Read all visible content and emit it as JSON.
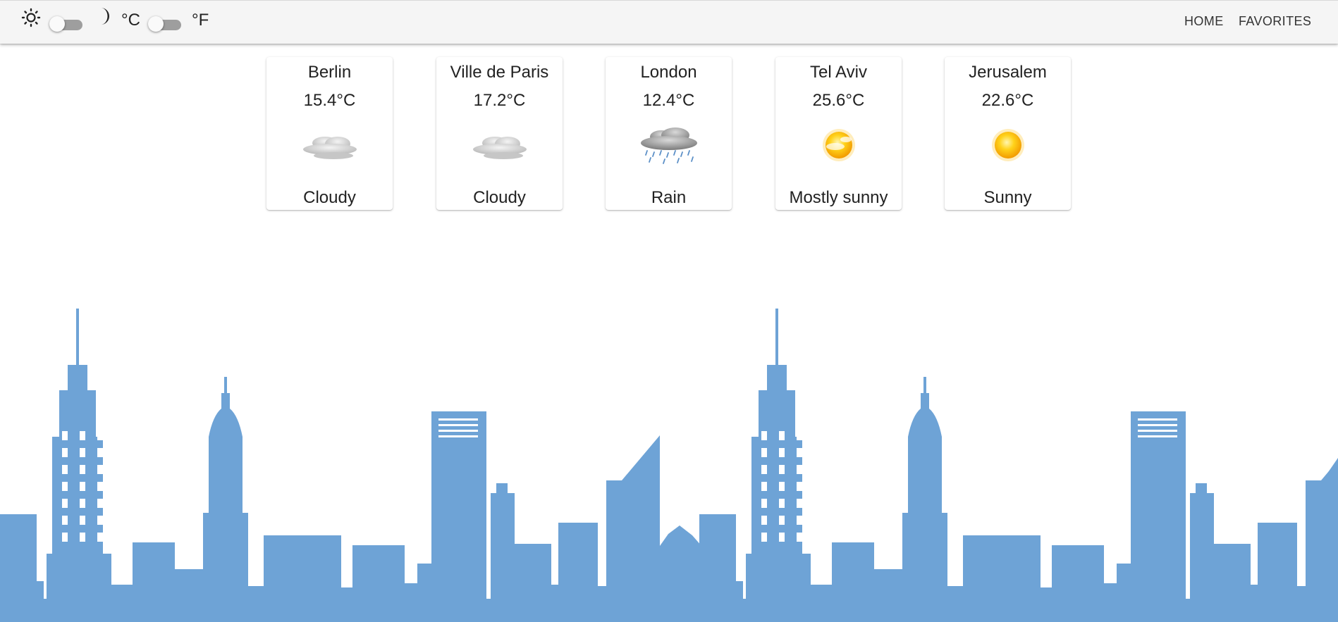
{
  "header": {
    "theme_light_icon": "sun-icon",
    "theme_dark_icon": "moon-icon",
    "unit_celsius": "°C",
    "unit_fahrenheit": "°F",
    "nav": {
      "home": "HOME",
      "favorites": "FAVORITES"
    }
  },
  "cities": [
    {
      "name": "Berlin",
      "temp": "15.4°C",
      "condition": "Cloudy",
      "icon": "cloudy-icon"
    },
    {
      "name": "Ville de Paris",
      "temp": "17.2°C",
      "condition": "Cloudy",
      "icon": "cloudy-icon"
    },
    {
      "name": "London",
      "temp": "12.4°C",
      "condition": "Rain",
      "icon": "rain-icon"
    },
    {
      "name": "Tel Aviv",
      "temp": "25.6°C",
      "condition": "Mostly sunny",
      "icon": "mostly-sunny-icon"
    },
    {
      "name": "Jerusalem",
      "temp": "22.6°C",
      "condition": "Sunny",
      "icon": "sunny-icon"
    }
  ],
  "colors": {
    "skyline": "#6ea3d6",
    "appbar": "#f5f5f5",
    "switch_track": "#9e9e9e"
  }
}
